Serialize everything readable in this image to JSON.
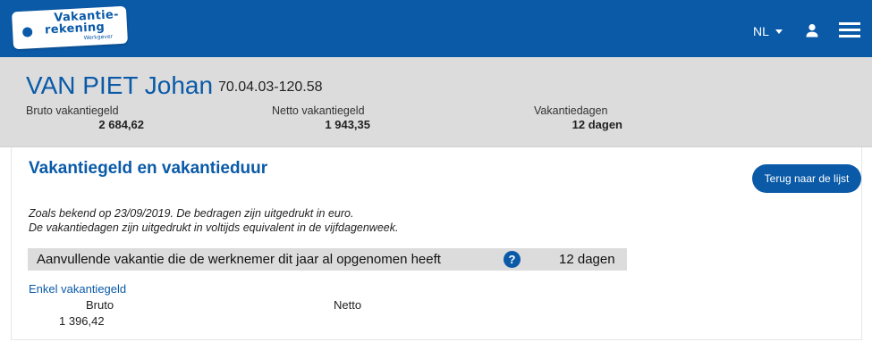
{
  "header": {
    "logo": {
      "line1": "Vakantie-",
      "line2": "rekening",
      "line3": "Werkgever"
    },
    "language": "NL",
    "icons": [
      "user-icon",
      "menu-icon"
    ],
    "colors": {
      "brand": "#0a5aa8",
      "band": "#dcdcdc"
    }
  },
  "employee": {
    "name": "VAN PIET Johan",
    "id": "70.04.03-120.58"
  },
  "summary": {
    "bruto_label": "Bruto vakantiegeld",
    "bruto_value": "2 684,62",
    "netto_label": "Netto vakantiegeld",
    "netto_value": "1 943,35",
    "days_label": "Vakantiedagen",
    "days_value": "12 dagen"
  },
  "section": {
    "title": "Vakantiegeld en vakantieduur",
    "back_button": "Terug naar de lijst",
    "note_line1": "Zoals bekend op 23/09/2019. De bedragen zijn uitgedrukt in euro.",
    "note_line2": "De vakantiedagen zijn uitgedrukt in voltijds equivalent in de vijfdagenweek.",
    "extra_leave_label": "Aanvullende vakantie die de werknemer dit jaar al opgenomen heeft",
    "extra_leave_help": "?",
    "extra_leave_value": "12 dagen",
    "single_pay_title": "Enkel vakantiegeld",
    "bruto_header": "Bruto",
    "netto_header": "Netto",
    "bruto_value": "1 396,42"
  }
}
